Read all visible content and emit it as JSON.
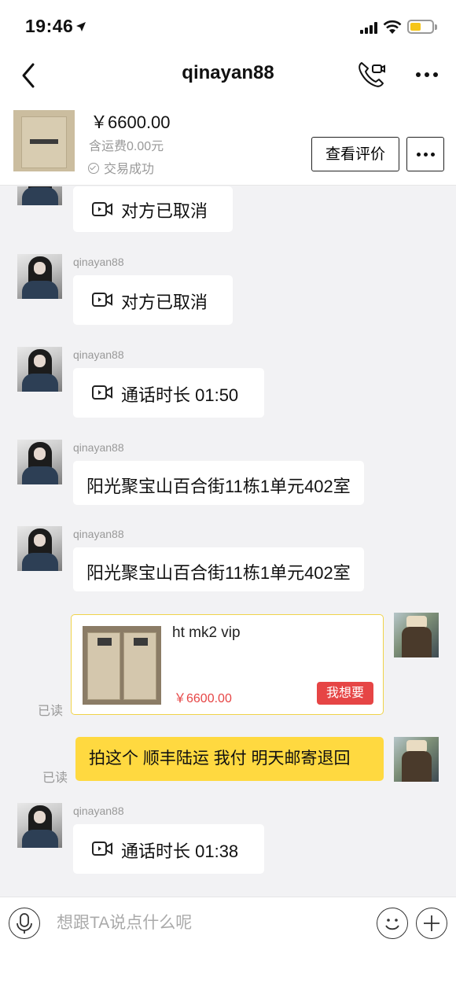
{
  "status_bar": {
    "time": "19:46"
  },
  "nav": {
    "title": "qinayan88"
  },
  "product": {
    "price": "￥6600.00",
    "shipping": "含运费0.00元",
    "status": "交易成功",
    "review_button": "查看评价"
  },
  "messages": [
    {
      "type": "call",
      "sender": "",
      "text": "对方已取消"
    },
    {
      "type": "call",
      "sender": "qinayan88",
      "text": "对方已取消"
    },
    {
      "type": "call",
      "sender": "qinayan88",
      "text": "通话时长 01:50"
    },
    {
      "type": "text",
      "sender": "qinayan88",
      "text": "阳光聚宝山百合街11栋1单元402室"
    },
    {
      "type": "text",
      "sender": "qinayan88",
      "text": "阳光聚宝山百合街11栋1单元402室"
    },
    {
      "type": "product_card",
      "title": "ht mk2 vip",
      "price": "￥6600.00",
      "button": "我想要",
      "read_status": "已读"
    },
    {
      "type": "text_self",
      "text": "拍这个 顺丰陆运 我付 明天邮寄退回",
      "read_status": "已读"
    },
    {
      "type": "call",
      "sender": "qinayan88",
      "text": "通话时长 01:38"
    }
  ],
  "input": {
    "placeholder": "想跟TA说点什么呢"
  },
  "colors": {
    "accent_yellow": "#ffd940",
    "price_red": "#e64545",
    "background": "#f2f2f4"
  }
}
